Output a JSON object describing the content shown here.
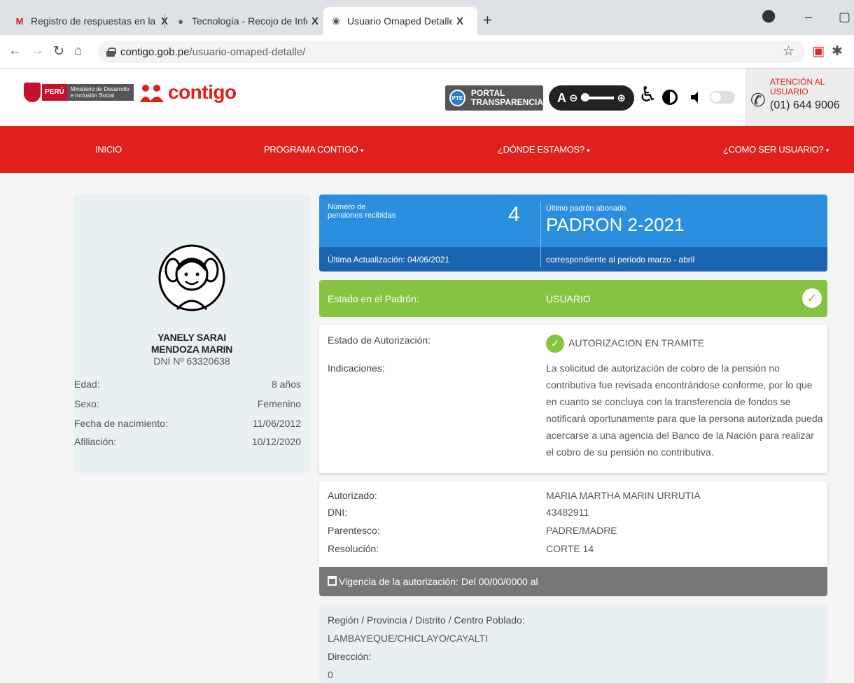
{
  "browser": {
    "tabs": [
      {
        "title": "Registro de respuestas en la plataforma",
        "close": "X"
      },
      {
        "title": "Tecnología - Recojo de Información",
        "close": "X"
      },
      {
        "title": "Usuario Omaped Detalle – Programa Contigo",
        "close": "X"
      }
    ],
    "url_host": "contigo.gob.pe",
    "url_path": "/usuario-omaped-detalle/"
  },
  "header": {
    "peru_label": "PERÚ",
    "ministry": "Ministerio de Desarrollo e Inclusión Social",
    "logo_text": "contigo",
    "pte_badge": "PTE",
    "portal_line1": "PORTAL",
    "portal_line2": "TRANSPARENCIA",
    "zoom_label": "A",
    "attention_line1": "ATENCIÓN AL",
    "attention_line2": "USUARIO",
    "phone": "(01) 644 9006"
  },
  "nav": {
    "items": [
      {
        "label": "INICIO",
        "caret": ""
      },
      {
        "label": "PROGRAMA CONTIGO",
        "caret": "▾"
      },
      {
        "label": "¿DÓNDE ESTAMOS?",
        "caret": "▾"
      },
      {
        "label": "¿COMO SER USUARIO?",
        "caret": "▾"
      }
    ]
  },
  "profile": {
    "name_line1": "YANELY SARAI",
    "name_line2": "MENDOZA MARIN",
    "dni": "DNI Nº 63320638",
    "rows": [
      {
        "label": "Edad:",
        "value": "8 años"
      },
      {
        "label": "Sexo:",
        "value": "Femenino"
      },
      {
        "label": "Fecha de nacimiento:",
        "value": "11/06/2012"
      },
      {
        "label": "Afiliación:",
        "value": "10/12/2020"
      }
    ]
  },
  "pension": {
    "count_label_line1": "Número de",
    "count_label_line2": "pensiones recibidas",
    "count": "4",
    "last_label": "Último padrón abonado",
    "last_value": "PADRON 2-2021",
    "updated": "Última Actualización: 04/06/2021",
    "period": "correspondiente al periodo marzo - abril"
  },
  "status": {
    "label": "Estado en el Padrón:",
    "value": "USUARIO",
    "accent": "#85c440"
  },
  "authorization": {
    "label": "Estado de Autorización:",
    "value": "AUTORIZACION EN TRAMITE",
    "indications_label": "Indicaciones:",
    "indications": "La solicitud de autorización de cobro de la pensión no contributiva fue revisada encontrándose conforme, por lo que en cuanto se concluya con la transferencia de fondos se notificará oportunamente para que la persona autorizada pueda acercarse a una agencia del Banco de la Nación para realizar el cobro de su pensión no contributiva."
  },
  "authorized": {
    "rows": [
      {
        "label": "Autorizado:",
        "value": "MARIA MARTHA MARIN URRUTIA"
      },
      {
        "label": "DNI:",
        "value": "43482911"
      },
      {
        "label": "Parentesco:",
        "value": "PADRE/MADRE"
      },
      {
        "label": "Resolución:",
        "value": "CORTE 14"
      }
    ],
    "validity": "Vigencia de la autorización: Del 00/00/0000 al"
  },
  "location": {
    "region_label": "Región / Provincia / Distrito / Centro Poblado:",
    "region_value": "LAMBAYEQUE/CHICLAYO/CAYALTI",
    "address_label": "Dirección:",
    "address_value": "0"
  },
  "colors": {
    "brand_red": "#e0201b",
    "blue": "#2b8fe0",
    "dark_blue": "#1b65b0",
    "green": "#85c440"
  }
}
